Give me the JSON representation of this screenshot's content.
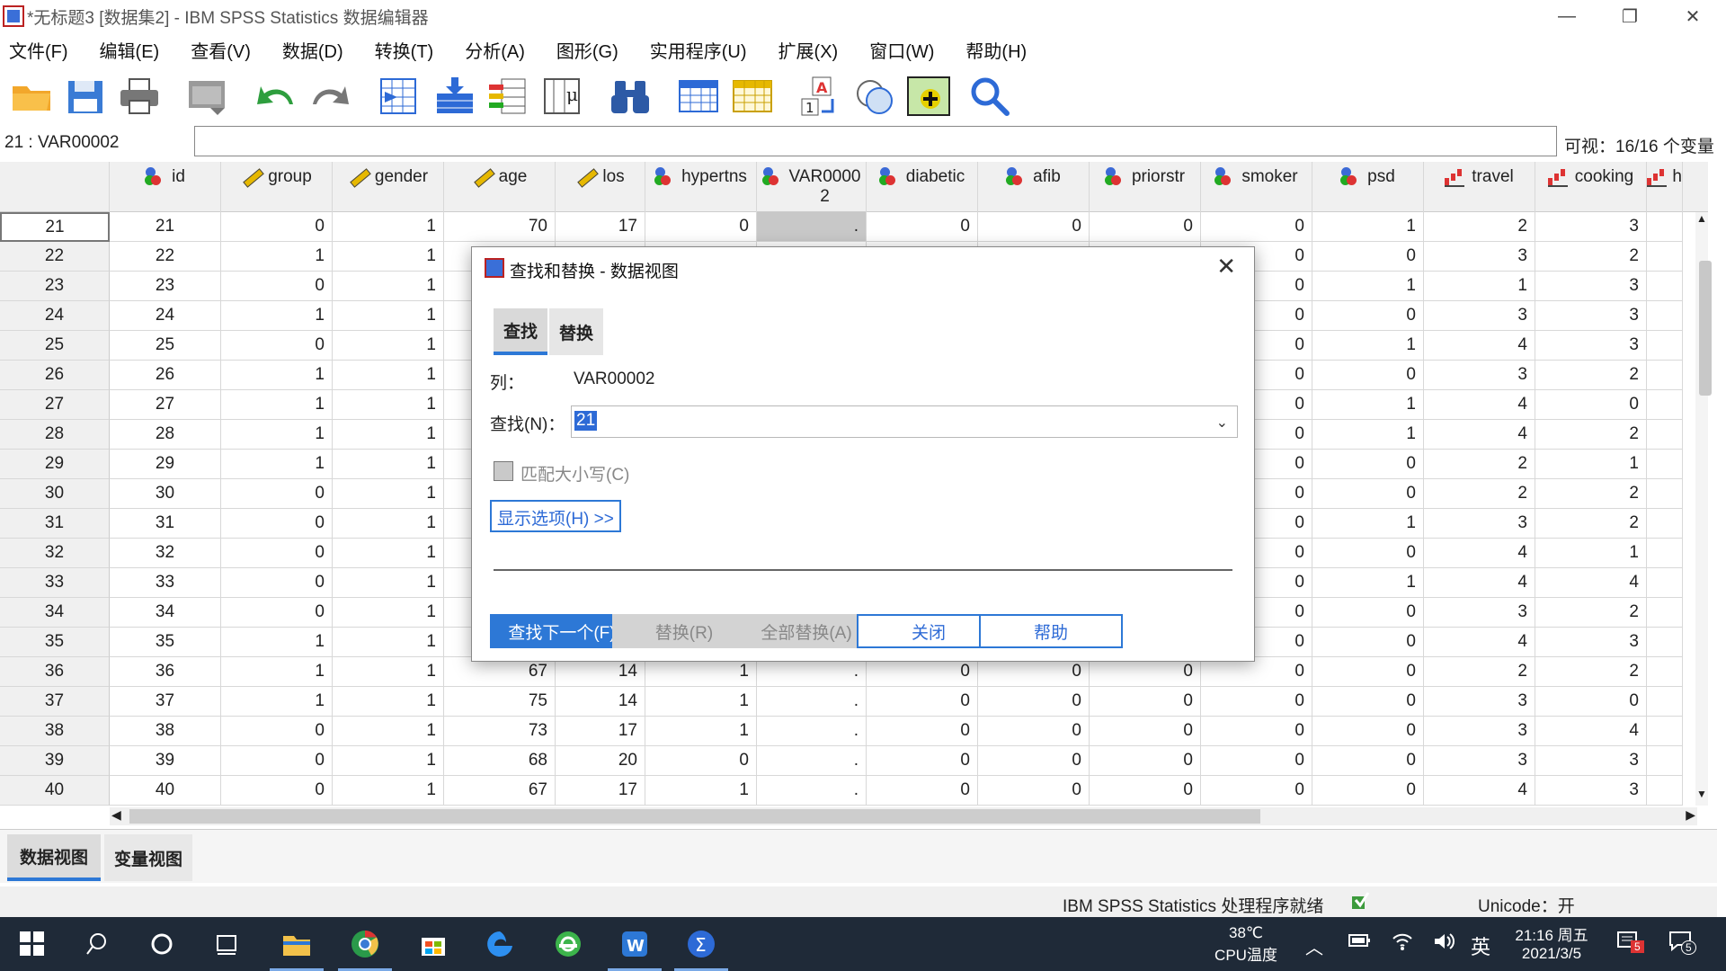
{
  "window": {
    "title": "*无标题3 [数据集2] - IBM SPSS Statistics 数据编辑器"
  },
  "menu": [
    "文件(F)",
    "编辑(E)",
    "查看(V)",
    "数据(D)",
    "转换(T)",
    "分析(A)",
    "图形(G)",
    "实用程序(U)",
    "扩展(X)",
    "窗口(W)",
    "帮助(H)"
  ],
  "refbar": {
    "cell_ref": "21 : VAR00002",
    "visible": "可视：16/16 个变量"
  },
  "columns": [
    {
      "name": "id",
      "icon": "nominal-icon"
    },
    {
      "name": "group",
      "icon": "scale-icon"
    },
    {
      "name": "gender",
      "icon": "scale-icon"
    },
    {
      "name": "age",
      "icon": "scale-icon"
    },
    {
      "name": "los",
      "icon": "scale-icon"
    },
    {
      "name": "hypertns",
      "icon": "nominal-icon"
    },
    {
      "name": "VAR0000\n2",
      "icon": "nominal-icon"
    },
    {
      "name": "diabetic",
      "icon": "nominal-icon"
    },
    {
      "name": "afib",
      "icon": "nominal-icon"
    },
    {
      "name": "priorstr",
      "icon": "nominal-icon"
    },
    {
      "name": "smoker",
      "icon": "nominal-icon"
    },
    {
      "name": "psd",
      "icon": "nominal-icon"
    },
    {
      "name": "travel",
      "icon": "ordinal-icon"
    },
    {
      "name": "cooking",
      "icon": "ordinal-icon"
    },
    {
      "name": "h",
      "icon": "ordinal-icon"
    }
  ],
  "rows": [
    {
      "n": "21",
      "cells": [
        "21",
        "0",
        "1",
        "70",
        "17",
        "0",
        ".",
        "0",
        "0",
        "0",
        "0",
        "1",
        "2",
        "3"
      ]
    },
    {
      "n": "22",
      "cells": [
        "22",
        "1",
        "1",
        "",
        "",
        "",
        "",
        "",
        "",
        "",
        "0",
        "0",
        "3",
        "2"
      ]
    },
    {
      "n": "23",
      "cells": [
        "23",
        "0",
        "1",
        "",
        "",
        "",
        "",
        "",
        "",
        "",
        "0",
        "1",
        "1",
        "3"
      ]
    },
    {
      "n": "24",
      "cells": [
        "24",
        "1",
        "1",
        "",
        "",
        "",
        "",
        "",
        "",
        "",
        "0",
        "0",
        "3",
        "3"
      ]
    },
    {
      "n": "25",
      "cells": [
        "25",
        "0",
        "1",
        "",
        "",
        "",
        "",
        "",
        "",
        "",
        "0",
        "1",
        "4",
        "3"
      ]
    },
    {
      "n": "26",
      "cells": [
        "26",
        "1",
        "1",
        "",
        "",
        "",
        "",
        "",
        "",
        "",
        "0",
        "0",
        "3",
        "2"
      ]
    },
    {
      "n": "27",
      "cells": [
        "27",
        "1",
        "1",
        "",
        "",
        "",
        "",
        "",
        "",
        "",
        "0",
        "1",
        "4",
        "0"
      ]
    },
    {
      "n": "28",
      "cells": [
        "28",
        "1",
        "1",
        "",
        "",
        "",
        "",
        "",
        "",
        "",
        "0",
        "1",
        "4",
        "2"
      ]
    },
    {
      "n": "29",
      "cells": [
        "29",
        "1",
        "1",
        "",
        "",
        "",
        "",
        "",
        "",
        "",
        "0",
        "0",
        "2",
        "1"
      ]
    },
    {
      "n": "30",
      "cells": [
        "30",
        "0",
        "1",
        "",
        "",
        "",
        "",
        "",
        "",
        "",
        "0",
        "0",
        "2",
        "2"
      ]
    },
    {
      "n": "31",
      "cells": [
        "31",
        "0",
        "1",
        "",
        "",
        "",
        "",
        "",
        "",
        "",
        "0",
        "1",
        "3",
        "2"
      ]
    },
    {
      "n": "32",
      "cells": [
        "32",
        "0",
        "1",
        "",
        "",
        "",
        "",
        "",
        "",
        "",
        "0",
        "0",
        "4",
        "1"
      ]
    },
    {
      "n": "33",
      "cells": [
        "33",
        "0",
        "1",
        "",
        "",
        "",
        "",
        "",
        "",
        "",
        "0",
        "1",
        "4",
        "4"
      ]
    },
    {
      "n": "34",
      "cells": [
        "34",
        "0",
        "1",
        "",
        "",
        "",
        "",
        "",
        "",
        "",
        "0",
        "0",
        "3",
        "2"
      ]
    },
    {
      "n": "35",
      "cells": [
        "35",
        "1",
        "1",
        "",
        "",
        "",
        "",
        "",
        "",
        "",
        "0",
        "0",
        "4",
        "3"
      ]
    },
    {
      "n": "36",
      "cells": [
        "36",
        "1",
        "1",
        "67",
        "14",
        "1",
        ".",
        "0",
        "0",
        "0",
        "0",
        "0",
        "2",
        "2"
      ]
    },
    {
      "n": "37",
      "cells": [
        "37",
        "1",
        "1",
        "75",
        "14",
        "1",
        ".",
        "0",
        "0",
        "0",
        "0",
        "0",
        "3",
        "0"
      ]
    },
    {
      "n": "38",
      "cells": [
        "38",
        "0",
        "1",
        "73",
        "17",
        "1",
        ".",
        "0",
        "0",
        "0",
        "0",
        "0",
        "3",
        "4"
      ]
    },
    {
      "n": "39",
      "cells": [
        "39",
        "0",
        "1",
        "68",
        "20",
        "0",
        ".",
        "0",
        "0",
        "0",
        "0",
        "0",
        "3",
        "3"
      ]
    },
    {
      "n": "40",
      "cells": [
        "40",
        "0",
        "1",
        "67",
        "17",
        "1",
        ".",
        "0",
        "0",
        "0",
        "0",
        "0",
        "4",
        "3"
      ]
    }
  ],
  "tabs": {
    "data_view": "数据视图",
    "variable_view": "变量视图"
  },
  "status": {
    "processor": "IBM SPSS Statistics 处理程序就绪",
    "unicode": "Unicode：开"
  },
  "dialog": {
    "title": "查找和替换 - 数据视图",
    "tab_find": "查找",
    "tab_replace": "替换",
    "column_label": "列：",
    "column_value": "VAR00002",
    "find_label": "查找(N)：",
    "find_value": "21",
    "match_case": "匹配大小写(C)",
    "show_options": "显示选项(H) >>",
    "btn_find_next": "查找下一个(F)",
    "btn_replace": "替换(R)",
    "btn_replace_all": "全部替换(A)",
    "btn_close": "关闭",
    "btn_help": "帮助"
  },
  "taskbar": {
    "temp": "38℃",
    "temp_label": "CPU温度",
    "ime": "英",
    "time": "21:16 周五",
    "date": "2021/3/5",
    "notif_badge": "5",
    "chat_badge": "5"
  },
  "colors": {
    "accent": "#2d78d6",
    "taskbar": "#1f2a38",
    "selected_cell": "#c8c8c8"
  }
}
